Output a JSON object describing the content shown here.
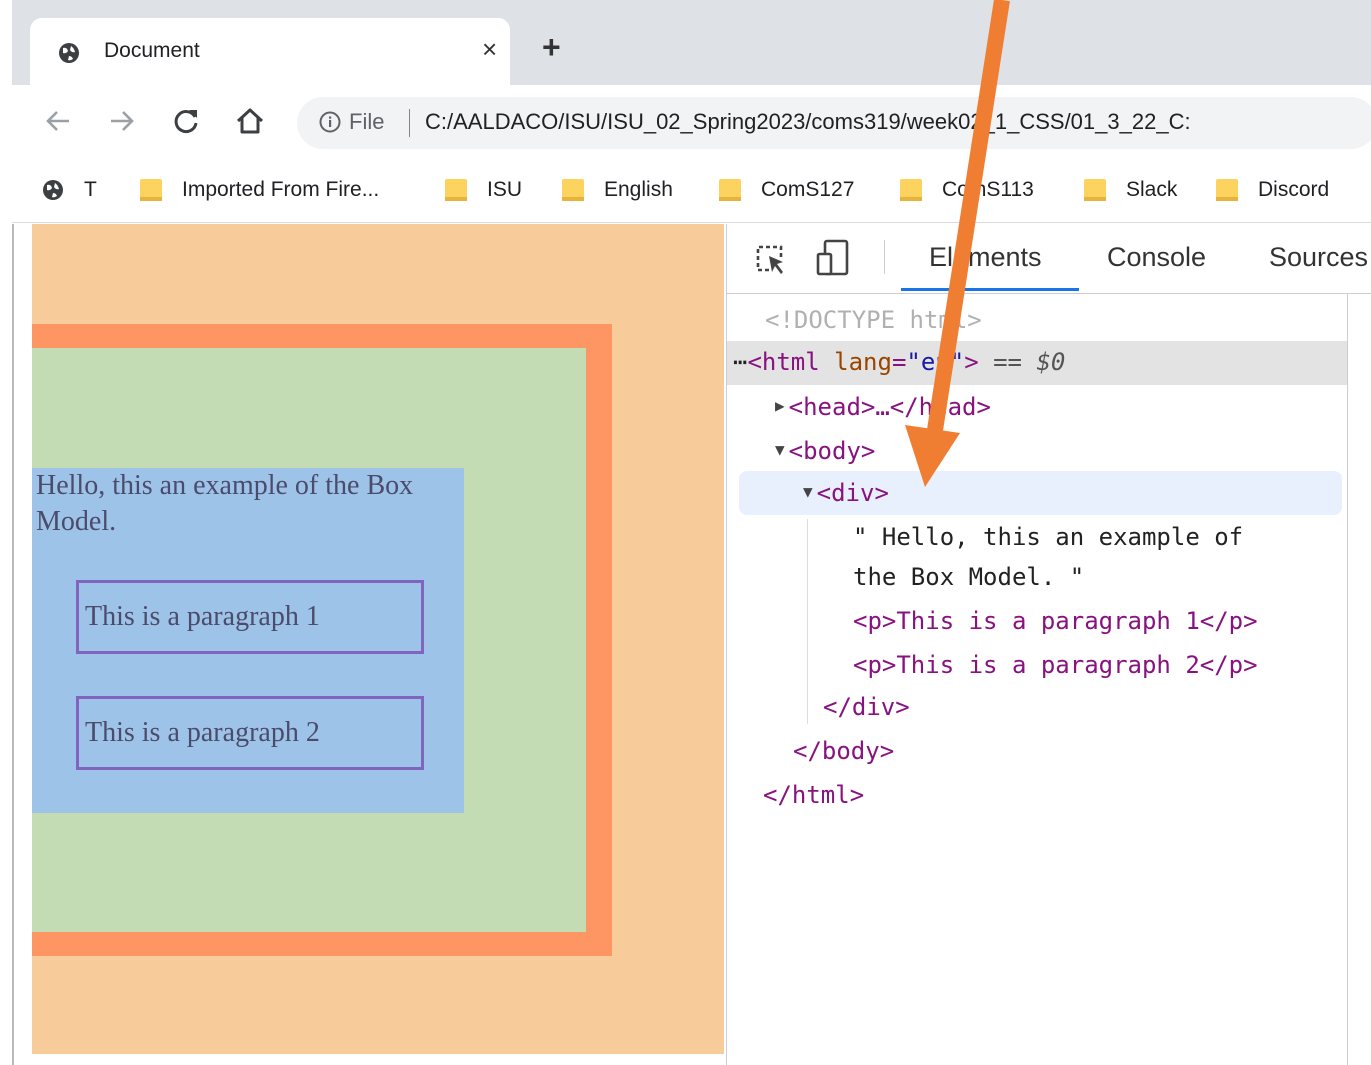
{
  "browser": {
    "tab_title": "Document",
    "tab_close": "×",
    "new_tab": "+",
    "address": {
      "scheme_label": "File",
      "url": "C:/AALDACO/ISU/ISU_02_Spring2023/coms319/week02_1_CSS/01_3_22_C:"
    },
    "bookmarks": [
      {
        "label": "T",
        "icon": "globe-icon"
      },
      {
        "label": "Imported From Fire...",
        "icon": "folder-icon"
      },
      {
        "label": "ISU",
        "icon": "folder-icon"
      },
      {
        "label": "English",
        "icon": "folder-icon"
      },
      {
        "label": "ComS127",
        "icon": "folder-icon"
      },
      {
        "label": "ComS113",
        "icon": "folder-icon"
      },
      {
        "label": "Slack",
        "icon": "folder-icon"
      },
      {
        "label": "Discord",
        "icon": "folder-icon"
      }
    ]
  },
  "page": {
    "div_text": "Hello, this an example of the Box Model.",
    "paragraphs": [
      "This is a paragraph 1",
      "This is a paragraph 2"
    ],
    "colors": {
      "margin": "#f7cb9a",
      "border": "#fd9662",
      "padding": "#c3dcb3",
      "content": "#9ec3e8",
      "p_border": "#8064be"
    }
  },
  "devtools": {
    "tabs": [
      "Elements",
      "Console",
      "Sources"
    ],
    "active_tab": "Elements",
    "dom": {
      "doctype": "<!DOCTYPE html>",
      "html_open_tag": "<html",
      "html_attr": "lang",
      "html_attr_value": "\"en\"",
      "html_close_bracket": ">",
      "selected_marker": "== $0",
      "head_collapsed": "<head>…</head>",
      "body_open": "<body>",
      "div_open": "<div>",
      "text_node_line1": "\" Hello, this an example of",
      "text_node_line2": "the Box Model. \"",
      "p1": "<p>This is a paragraph 1</p>",
      "p2": "<p>This is a paragraph 2</p>",
      "div_close": "</div>",
      "body_close": "</body>",
      "html_close": "</html>"
    }
  },
  "annotation": {
    "arrow_color": "#f07e32"
  }
}
